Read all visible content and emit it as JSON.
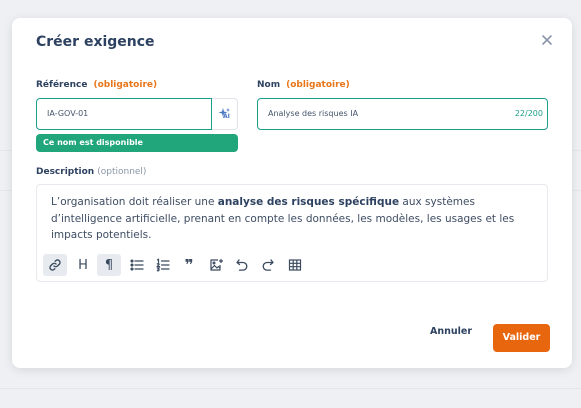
{
  "dialog": {
    "title": "Créer exigence",
    "reference": {
      "label": "Référence",
      "required": "(obligatoire)",
      "value": "IA-GOV-01",
      "ai_badge": "AI",
      "status": "Ce nom est disponible"
    },
    "name": {
      "label": "Nom",
      "required": "(obligatoire)",
      "value": "Analyse des risques IA",
      "counter": "22/200"
    },
    "description": {
      "label": "Description",
      "optional": "(optionnel)",
      "text_before": "L’organisation doit réaliser une ",
      "text_bold": "analyse des risques spécifique",
      "text_after": " aux systèmes d’intelligence artificielle, prenant en compte les données, les modèles, les usages et les impacts potentiels."
    },
    "toolbar": {
      "heading_glyph": "H",
      "paragraph_glyph": "¶",
      "quote_glyph": "❞",
      "icons": [
        "link-icon",
        "heading-icon",
        "paragraph-icon",
        "bullet-list-icon",
        "ordered-list-icon",
        "quote-icon",
        "image-icon",
        "undo-icon",
        "redo-icon",
        "table-icon"
      ]
    },
    "actions": {
      "cancel": "Annuler",
      "submit": "Valider"
    }
  },
  "colors": {
    "accent": "#e8660e",
    "required": "#e8761a",
    "success": "#21a67c",
    "focus_border": "#1b9e8a",
    "title": "#2d4160"
  }
}
